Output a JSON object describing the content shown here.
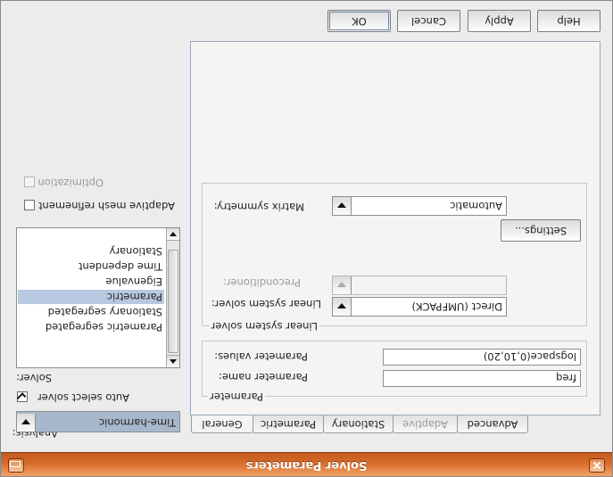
{
  "window": {
    "title": "Solver Parameters"
  },
  "buttons": {
    "ok": "OK",
    "cancel": "Cancel",
    "apply": "Apply",
    "help": "Help"
  },
  "left": {
    "analysis_label": "Analysis:",
    "analysis_value": "Time-harmonic",
    "auto_select_label": "Auto select solver",
    "auto_select_checked": true,
    "solver_label": "Solver:",
    "solvers": [
      "Stationary",
      "Time dependent",
      "Eigenvalue",
      "Parametric",
      "Stationary segregated",
      "Parametric segregated"
    ],
    "selected_solver": "Parametric",
    "adaptive_label": "Adaptive mesh refinement",
    "adaptive_checked": false,
    "optimization_label": "Optimization",
    "optimization_checked": false
  },
  "tabs": [
    {
      "label": "General",
      "selected": true,
      "enabled": true
    },
    {
      "label": "Parametric",
      "selected": false,
      "enabled": true
    },
    {
      "label": "Stationary",
      "selected": false,
      "enabled": true
    },
    {
      "label": "Adaptive",
      "selected": false,
      "enabled": false
    },
    {
      "label": "Advanced",
      "selected": false,
      "enabled": true
    }
  ],
  "general": {
    "parameter_group_title": "Parameter",
    "parameter_name_label": "Parameter name:",
    "parameter_name_value": "freq",
    "parameter_values_label": "Parameter values:",
    "parameter_values_value": "logspace(0,10,20)",
    "linear_group_title": "Linear system solver",
    "linear_solver_label": "Linear system solver:",
    "linear_solver_value": "Direct (UMFPACK)",
    "preconditioner_label": "Preconditioner:",
    "preconditioner_value": "",
    "settings_button": "Settings...",
    "matrix_symmetry_label": "Matrix symmetry:",
    "matrix_symmetry_value": "Automatic"
  }
}
